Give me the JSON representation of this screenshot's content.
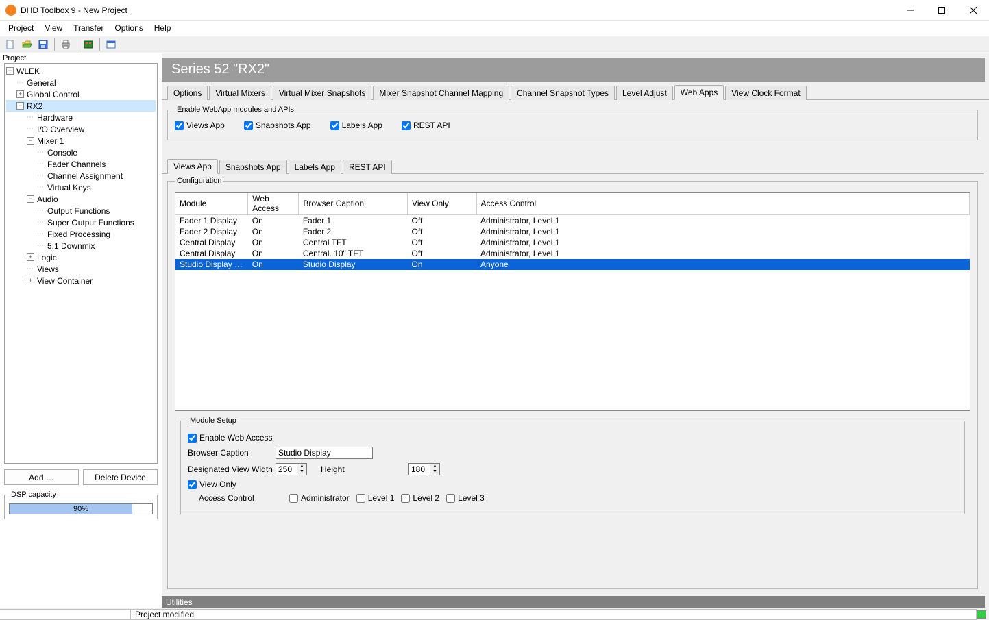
{
  "titlebar": {
    "title": "DHD Toolbox 9 - New Project"
  },
  "menu": [
    "Project",
    "View",
    "Transfer",
    "Options",
    "Help"
  ],
  "project_tree": {
    "label": "Project",
    "root": "WLEK",
    "items": [
      "General",
      "Global Control",
      "RX2",
      "Hardware",
      "I/O Overview",
      "Mixer 1",
      "Console",
      "Fader Channels",
      "Channel Assignment",
      "Virtual Keys",
      "Audio",
      "Output Functions",
      "Super Output Functions",
      "Fixed Processing",
      "5.1 Downmix",
      "Logic",
      "Views",
      "View Container"
    ]
  },
  "sidebar_buttons": {
    "add": "Add …",
    "delete": "Delete Device"
  },
  "dsp": {
    "legend": "DSP capacity",
    "percent": "90%",
    "fill": 86
  },
  "header": "Series 52 \"RX2\"",
  "top_tabs": [
    "Options",
    "Virtual Mixers",
    "Virtual Mixer Snapshots",
    "Mixer Snapshot Channel Mapping",
    "Channel Snapshot Types",
    "Level Adjust",
    "Web Apps",
    "View Clock Format"
  ],
  "top_tabs_active": 6,
  "enable_group": {
    "legend": "Enable WebApp modules and APIs",
    "checks": [
      {
        "label": "Views App",
        "checked": true
      },
      {
        "label": "Snapshots App",
        "checked": true
      },
      {
        "label": "Labels App",
        "checked": true
      },
      {
        "label": "REST API",
        "checked": true
      }
    ]
  },
  "sub_tabs": [
    "Views App",
    "Snapshots App",
    "Labels App",
    "REST API"
  ],
  "sub_tabs_active": 0,
  "config": {
    "legend": "Configuration",
    "headers": [
      "Module",
      "Web Access",
      "Browser Caption",
      "View Only",
      "Access Control"
    ],
    "rows": [
      [
        "Fader 1 Display",
        "On",
        "Fader 1",
        "Off",
        "Administrator, Level 1"
      ],
      [
        "Fader 2 Display",
        "On",
        "Fader 2",
        "Off",
        "Administrator, Level 1"
      ],
      [
        "Central Display",
        "On",
        "Central TFT",
        "Off",
        "Administrator, Level 1"
      ],
      [
        "Central Display",
        "On",
        "Central. 10\" TFT",
        "Off",
        "Administrator, Level 1"
      ],
      [
        "Studio Display …",
        "On",
        "Studio Display",
        "On",
        "Anyone"
      ]
    ],
    "selected": 4
  },
  "module_setup": {
    "legend": "Module Setup",
    "enable_label": "Enable Web Access",
    "enable_checked": true,
    "caption_label": "Browser Caption",
    "caption_value": "Studio Display",
    "width_label": "Designated View Width",
    "width_value": "250",
    "height_label": "Height",
    "height_value": "180",
    "viewonly_label": "View Only",
    "viewonly_checked": true,
    "access_label": "Access Control",
    "levels": [
      {
        "label": "Administrator",
        "checked": false
      },
      {
        "label": "Level 1",
        "checked": false
      },
      {
        "label": "Level 2",
        "checked": false
      },
      {
        "label": "Level 3",
        "checked": false
      }
    ]
  },
  "utilities": "Utilities",
  "status": "Project modified"
}
